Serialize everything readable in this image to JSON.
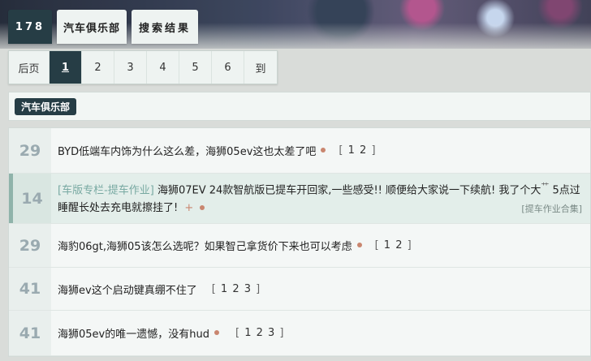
{
  "breadcrumb": {
    "forum_id": "178",
    "forum_name": "汽车俱乐部",
    "page": "搜索结果"
  },
  "pager": {
    "prev": "后页",
    "pages": [
      "1",
      "2",
      "3",
      "4",
      "5",
      "6"
    ],
    "current": "1",
    "goto": "到"
  },
  "forum_tag": "汽车俱乐部",
  "threads": [
    {
      "count": "29",
      "title": "BYD低端车内饰为什么这么差，海狮05ev这也太差了吧",
      "pages_open": "[",
      "pages": "1 2",
      "pages_close": "]"
    },
    {
      "count": "14",
      "prefix": "[车版专栏-提车作业]",
      "title": "海狮07EV 24款智航版已提车开回家,一些感受!! 顺便给大家说一下续航! 我了个大",
      "title_sup": "艹",
      "title_tail": "5点过睡醒长处去充电就擦挂了!",
      "plus": "+",
      "tag": "[提车作业合集]"
    },
    {
      "count": "29",
      "title": "海豹06gt,海狮05该怎么选呢？如果智己拿货价下来也可以考虑",
      "pages_open": "[",
      "pages": "1 2",
      "pages_close": "]"
    },
    {
      "count": "41",
      "title": "海狮ev这个启动键真绷不住了",
      "pages_open": "[",
      "pages": "1 2 3",
      "pages_close": "]"
    },
    {
      "count": "41",
      "title": "海狮05ev的唯一遗憾，没有hud",
      "pages_open": "[",
      "pages": "1 2 3",
      "pages_close": "]"
    }
  ],
  "colors": {
    "accent_dark": "#263d45",
    "dot": "#c9866f",
    "prefix": "#78a9a2"
  }
}
